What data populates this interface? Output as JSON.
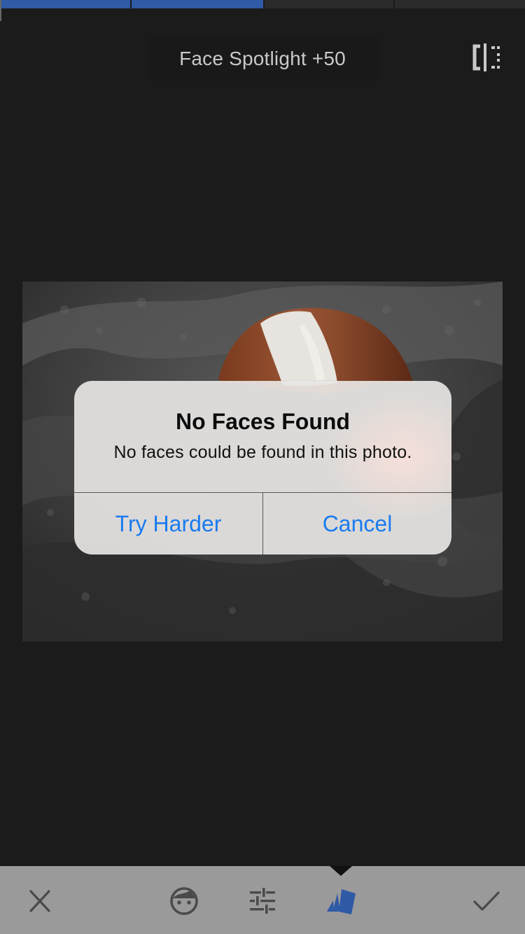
{
  "progress": {
    "filled_fraction": 0.5,
    "segments": 4
  },
  "header": {
    "adjustment_label": "Face Spotlight +50",
    "compare_icon": "compare-split-icon"
  },
  "photo": {
    "subject": "dog-in-blanket-photo"
  },
  "alert": {
    "title": "No Faces Found",
    "message": "No faces could be found in this photo.",
    "buttons": {
      "left": "Try Harder",
      "right": "Cancel"
    },
    "button_color": "#1a7bf0"
  },
  "toolbar": {
    "items": [
      {
        "name": "close-icon",
        "active": false
      },
      {
        "name": "face-icon",
        "active": false
      },
      {
        "name": "sliders-icon",
        "active": false
      },
      {
        "name": "styles-cards-icon",
        "active": true
      },
      {
        "name": "checkmark-icon",
        "active": false
      }
    ],
    "active_color": "#2f5aa6",
    "icon_color": "#4a4a4a"
  }
}
